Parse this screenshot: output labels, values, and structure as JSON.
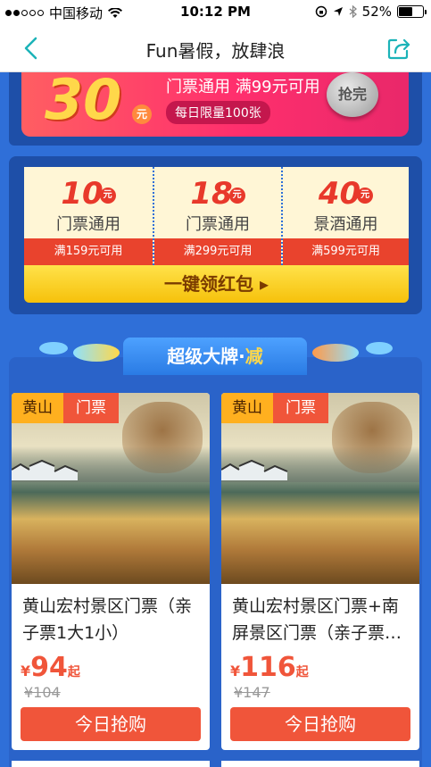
{
  "status_bar": {
    "carrier": "中国移动",
    "time": "10:12 PM",
    "battery": "52%",
    "battery_level": 0.52
  },
  "nav": {
    "title": "Fun暑假，放肆浪",
    "back_icon": "chevron-left-icon",
    "share_icon": "share-icon",
    "accent": "#1bb3b8"
  },
  "top_coupon": {
    "amount": "30",
    "unit": "元",
    "desc": "门票通用 满99元可用",
    "limit": "每日限量100张",
    "button": "抢完"
  },
  "packets": [
    {
      "amount": "10",
      "unit": "元",
      "name": "门票通用",
      "condition": "满159元可用"
    },
    {
      "amount": "18",
      "unit": "元",
      "name": "门票通用",
      "condition": "满299元可用"
    },
    {
      "amount": "40",
      "unit": "元",
      "name": "景酒通用",
      "condition": "满599元可用"
    }
  ],
  "get_all_button": "一键领红包 ▸",
  "section": {
    "title": "超级大牌·",
    "highlight": "减"
  },
  "products": [
    {
      "tag_place": "黄山",
      "tag_type": "门票",
      "title": "黄山宏村景区门票（亲子票1大1小）",
      "currency": "¥",
      "price": "94",
      "price_suffix": "起",
      "original_price": "¥104",
      "buy_label": "今日抢购"
    },
    {
      "tag_place": "黄山",
      "tag_type": "门票",
      "title": "黄山宏村景区门票+南屏景区门票（亲子票…",
      "currency": "¥",
      "price": "116",
      "price_suffix": "起",
      "original_price": "¥147",
      "buy_label": "今日抢购"
    }
  ],
  "colors": {
    "page_bg": "#2f6fd8",
    "panel_bg": "#1e4fa8",
    "coupon_red": "#e8392b",
    "price_red": "#f0553a",
    "tag_yellow": "#ffb01f"
  }
}
